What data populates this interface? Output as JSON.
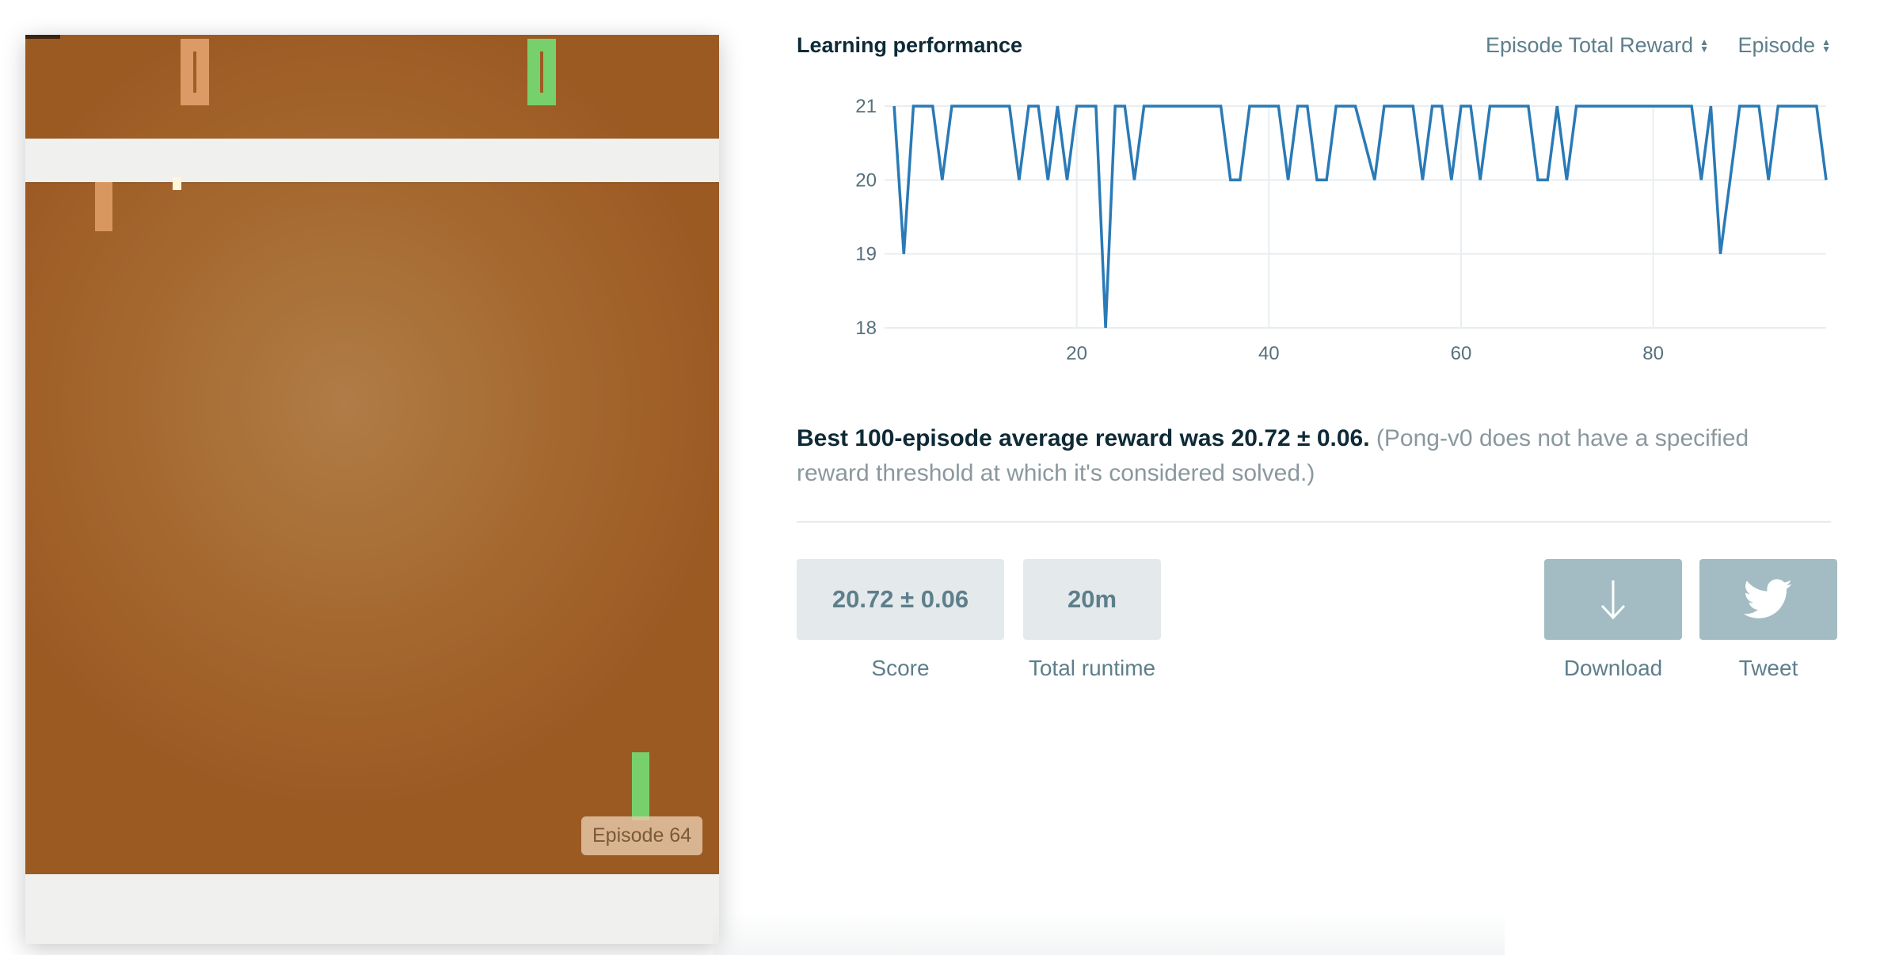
{
  "game": {
    "episode_label": "Episode 64",
    "colors": {
      "court": "#a5692f",
      "left_player": "#dc9a66",
      "right_player": "#77d06c",
      "wall": "#f0f0ef"
    }
  },
  "panel": {
    "title": "Learning performance",
    "metric_select": {
      "value": "Episode Total Reward",
      "icon": "sort-icon"
    },
    "axis_select": {
      "value": "Episode",
      "icon": "sort-icon"
    },
    "summary": {
      "lead": "Best 100-episode average reward was 20.72 ± 0.06.",
      "note": "(Pong-v0 does not have a specified reward threshold at which it's considered solved.)"
    },
    "stats": [
      {
        "value": "20.72 ± 0.06",
        "label": "Score"
      },
      {
        "value": "20m",
        "label": "Total runtime"
      }
    ],
    "actions": [
      {
        "label": "Download",
        "icon": "download-arrow-icon"
      },
      {
        "label": "Tweet",
        "icon": "twitter-bird-icon"
      }
    ],
    "accent_color": "#2a7ab6"
  },
  "chart_data": {
    "type": "line",
    "title": "",
    "xlabel": "",
    "ylabel": "",
    "xlim": [
      0,
      98
    ],
    "ylim": [
      18,
      21
    ],
    "xticks": [
      20,
      40,
      60,
      80
    ],
    "yticks": [
      18,
      19,
      20,
      21
    ],
    "grid": true,
    "series": [
      {
        "x": [
          1,
          2,
          3,
          5,
          6,
          7,
          8,
          13,
          14,
          15,
          16,
          17,
          18,
          19,
          20,
          21,
          22,
          23,
          24,
          25,
          26,
          27,
          28,
          35,
          36,
          37,
          38,
          40,
          41,
          42,
          43,
          44,
          45,
          46,
          47,
          48,
          49,
          51,
          52,
          53,
          54,
          55,
          56,
          57,
          58,
          59,
          60,
          61,
          62,
          63,
          67,
          68,
          69,
          70,
          71,
          72,
          73,
          80,
          84,
          85,
          86,
          87,
          88,
          89,
          90,
          91,
          92,
          93,
          96,
          97,
          98
        ],
        "values": [
          21,
          19,
          21,
          21,
          20,
          21,
          21,
          21,
          20,
          21,
          21,
          20,
          21,
          20,
          21,
          21,
          21,
          18,
          21,
          21,
          20,
          21,
          21,
          21,
          20,
          20,
          21,
          21,
          21,
          20,
          21,
          21,
          20,
          20,
          21,
          21,
          21,
          20,
          21,
          21,
          21,
          21,
          20,
          21,
          21,
          20,
          21,
          21,
          20,
          21,
          21,
          20,
          20,
          21,
          20,
          21,
          21,
          21,
          21,
          20,
          21,
          19,
          20,
          21,
          21,
          21,
          20,
          21,
          21,
          21,
          20
        ],
        "color": "#2a7ab6"
      }
    ]
  }
}
